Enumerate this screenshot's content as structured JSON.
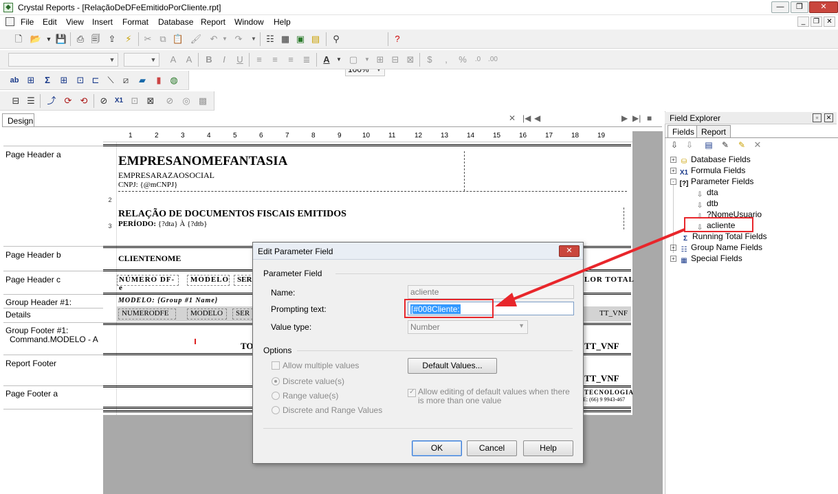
{
  "window": {
    "title": "Crystal Reports - [RelaçãoDeDFeEmitidoPorCliente.rpt]"
  },
  "menu": [
    "File",
    "Edit",
    "View",
    "Insert",
    "Format",
    "Database",
    "Report",
    "Window",
    "Help"
  ],
  "toolbar": {
    "zoom": "100%"
  },
  "design": {
    "tab": "Design",
    "sections": [
      {
        "name": "Page Header a"
      },
      {
        "name": "Page Header b"
      },
      {
        "name": "Page Header c"
      },
      {
        "name": "Group Header #1:"
      },
      {
        "name": "Details"
      },
      {
        "name": "Group Footer #1:"
      },
      {
        "name": "Command.MODELO - A"
      },
      {
        "name": "Report Footer"
      },
      {
        "name": "Page Footer a"
      }
    ],
    "ruler_numbers": [
      "1",
      "2",
      "3",
      "4",
      "5",
      "6",
      "7",
      "8",
      "9",
      "10",
      "11",
      "12",
      "13",
      "14",
      "15",
      "16",
      "17",
      "18",
      "19"
    ],
    "vruler_numbers": [
      "2",
      "3"
    ]
  },
  "report": {
    "company": "EMPRESANOMEFANTASIA",
    "razao": "EMPRESARAZAOSOCIAL",
    "cnpj": "CNPJ: {@mCNPJ}",
    "title": "RELAÇÃO DE DOCUMENTOS FISCAIS EMITIDOS",
    "periodo_label": "PERÍODO:",
    "periodo_value": "{?dta} À {?dtb}",
    "clientenome": "CLIENTENOME",
    "col_numero": "NÚMERO DF-e",
    "col_modelo": "MODELO",
    "col_serie": "SER",
    "col_valor": "LOR TOTAL",
    "group_header": "MODELO: {Group #1 Name}",
    "det_numero": "NUMERODFE",
    "det_modelo": "MODELO",
    "det_serie": "SER",
    "det_tt": "TT_VNF",
    "gf_to": "TO",
    "gf_tt": "TT_VNF",
    "rf_tt": "TT_VNF",
    "pf_tec": "TECNOLOGIA",
    "pf_phone": "E: (66) 9 9943-467"
  },
  "field_explorer": {
    "title": "Field Explorer",
    "tabs": [
      "Fields",
      "Report"
    ],
    "tree": [
      {
        "label": "Database Fields",
        "icon": "database-icon",
        "expander": "+",
        "children": []
      },
      {
        "label": "Formula Fields",
        "icon": "formula-icon",
        "expander": "+",
        "children": []
      },
      {
        "label": "Parameter Fields",
        "icon": "parameter-icon",
        "expander": "-",
        "children": [
          "dta",
          "dtb",
          "?NomeUsuario",
          "acliente"
        ]
      },
      {
        "label": "Running Total Fields",
        "icon": "sigma-icon",
        "expander": "",
        "children": []
      },
      {
        "label": "Group Name Fields",
        "icon": "group-icon",
        "expander": "+",
        "children": []
      },
      {
        "label": "Special Fields",
        "icon": "special-icon",
        "expander": "+",
        "children": []
      }
    ]
  },
  "dialog": {
    "title": "Edit Parameter Field",
    "section_parameter": "Parameter Field",
    "name_label": "Name:",
    "name_value": "acliente",
    "prompt_label": "Prompting text:",
    "prompt_value": "[#008Cliente:",
    "type_label": "Value type:",
    "type_value": "Number",
    "options_label": "Options",
    "allow_multiple": "Allow multiple values",
    "discrete": "Discrete value(s)",
    "range": "Range value(s)",
    "discrete_range": "Discrete and Range Values",
    "default_values": "Default Values...",
    "allow_editing": "Allow editing of default values when there is more than one value",
    "ok": "OK",
    "cancel": "Cancel",
    "help": "Help"
  },
  "colors": {
    "highlight": "#e8262b",
    "selection": "#3399ff"
  }
}
